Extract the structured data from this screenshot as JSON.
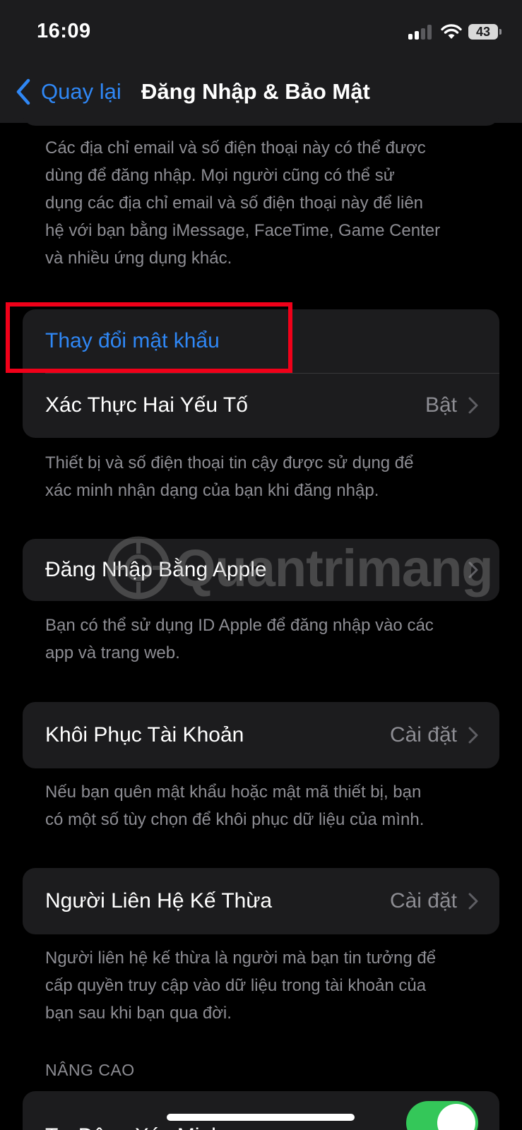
{
  "status_bar": {
    "time": "16:09",
    "battery": "43"
  },
  "nav": {
    "back_label": "Quay lại",
    "title": "Đăng Nhập & Bảo Mật"
  },
  "intro_footer": {
    "lines": [
      "Các địa chỉ email và số điện thoại này có thể được",
      "dùng để đăng nhập. Mọi người cũng có thể sử",
      "dụng các địa chỉ email và số điện thoại này để liên",
      "hệ với bạn bằng iMessage, FaceTime, Game Center",
      "và nhiều ứng dụng khác."
    ]
  },
  "password_group": {
    "change_password": "Thay đổi mật khẩu",
    "two_factor_label": "Xác Thực Hai Yếu Tố",
    "two_factor_value": "Bật",
    "footer_lines": [
      "Thiết bị và số điện thoại tin cậy được sử dụng để",
      "xác minh nhận dạng của bạn khi đăng nhập."
    ]
  },
  "apple_signin": {
    "label": "Đăng Nhập Bằng Apple",
    "footer_lines": [
      "Bạn có thể sử dụng ID Apple để đăng nhập vào các",
      "app và trang web."
    ]
  },
  "account_recovery": {
    "label": "Khôi Phục Tài Khoản",
    "value": "Cài đặt",
    "footer_lines": [
      "Nếu bạn quên mật khẩu hoặc mật mã thiết bị, bạn",
      "có một số tùy chọn để khôi phục dữ liệu của mình."
    ]
  },
  "legacy_contact": {
    "label": "Người Liên Hệ Kế Thừa",
    "value": "Cài đặt",
    "footer_lines": [
      "Người liên hệ kế thừa là người mà bạn tin tưởng để",
      "cấp quyền truy cập vào dữ liệu trong tài khoản của",
      "bạn sau khi bạn qua đời."
    ]
  },
  "advanced": {
    "header": "NÂNG CAO",
    "auto_verify_label": "Tự Động Xác Minh",
    "auto_verify_on": true
  },
  "watermark": {
    "text": "Quantrimang"
  },
  "colors": {
    "accent": "#2f87f5",
    "toggle_on": "#34c759",
    "highlight": "#f00019"
  }
}
